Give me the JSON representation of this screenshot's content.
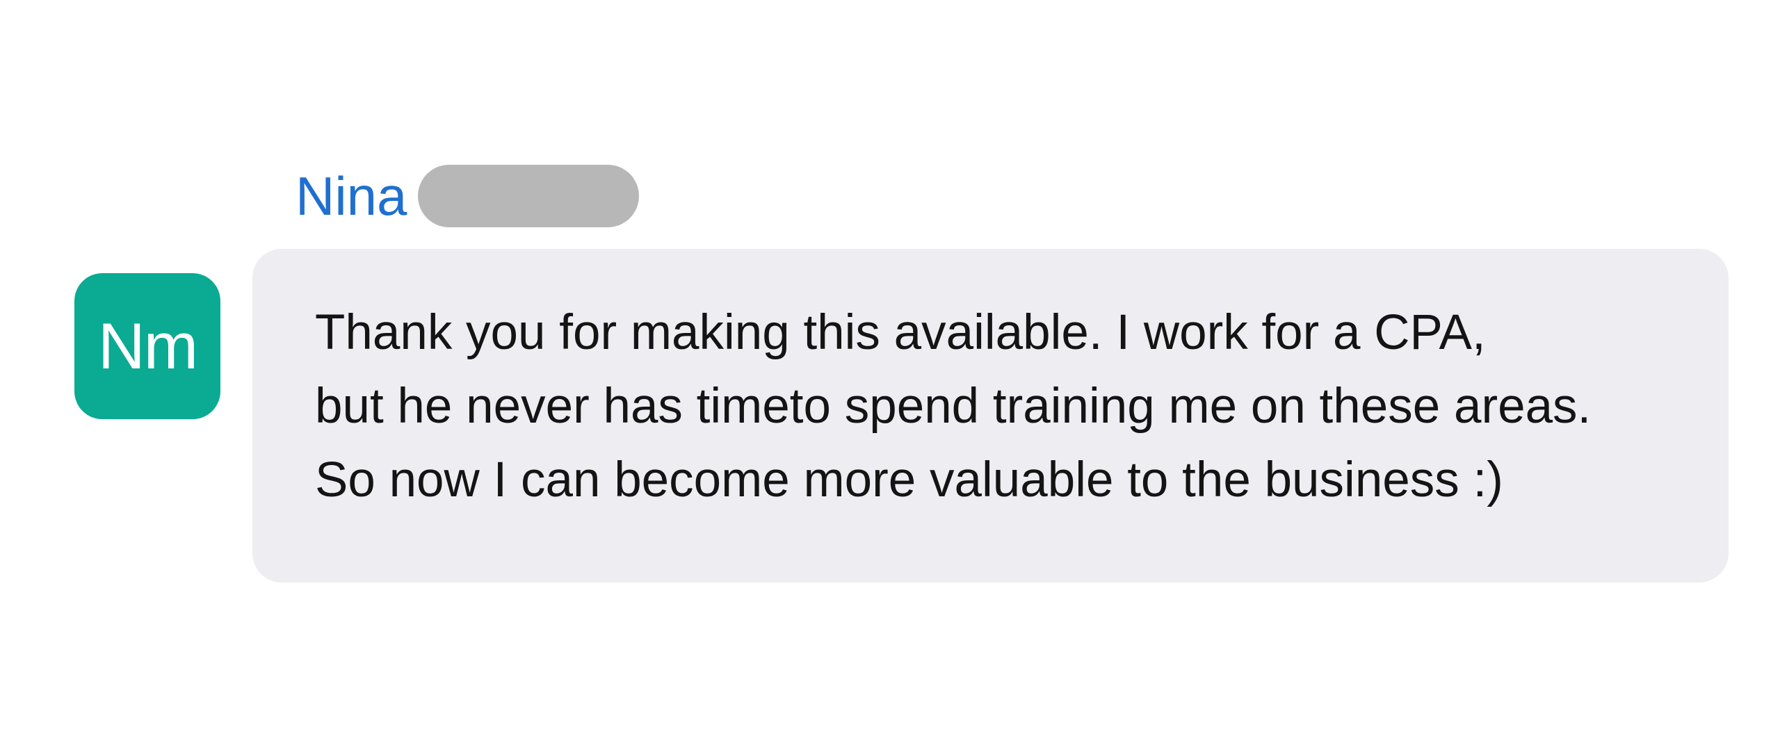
{
  "message": {
    "author": {
      "first_name": "Nina",
      "surname_redacted": true
    },
    "avatar": {
      "initials": "Nm",
      "color": "#0aaa93"
    },
    "text_lines": [
      "Thank you for making this available. I work for a CPA,",
      "but he never has timeto spend training me on these areas.",
      "So now I can become more valuable to the business :)"
    ]
  },
  "colors": {
    "author_name": "#1f6fd0",
    "bubble_background": "#eeedf2",
    "redaction": "#b7b7b7",
    "text": "#141414"
  }
}
